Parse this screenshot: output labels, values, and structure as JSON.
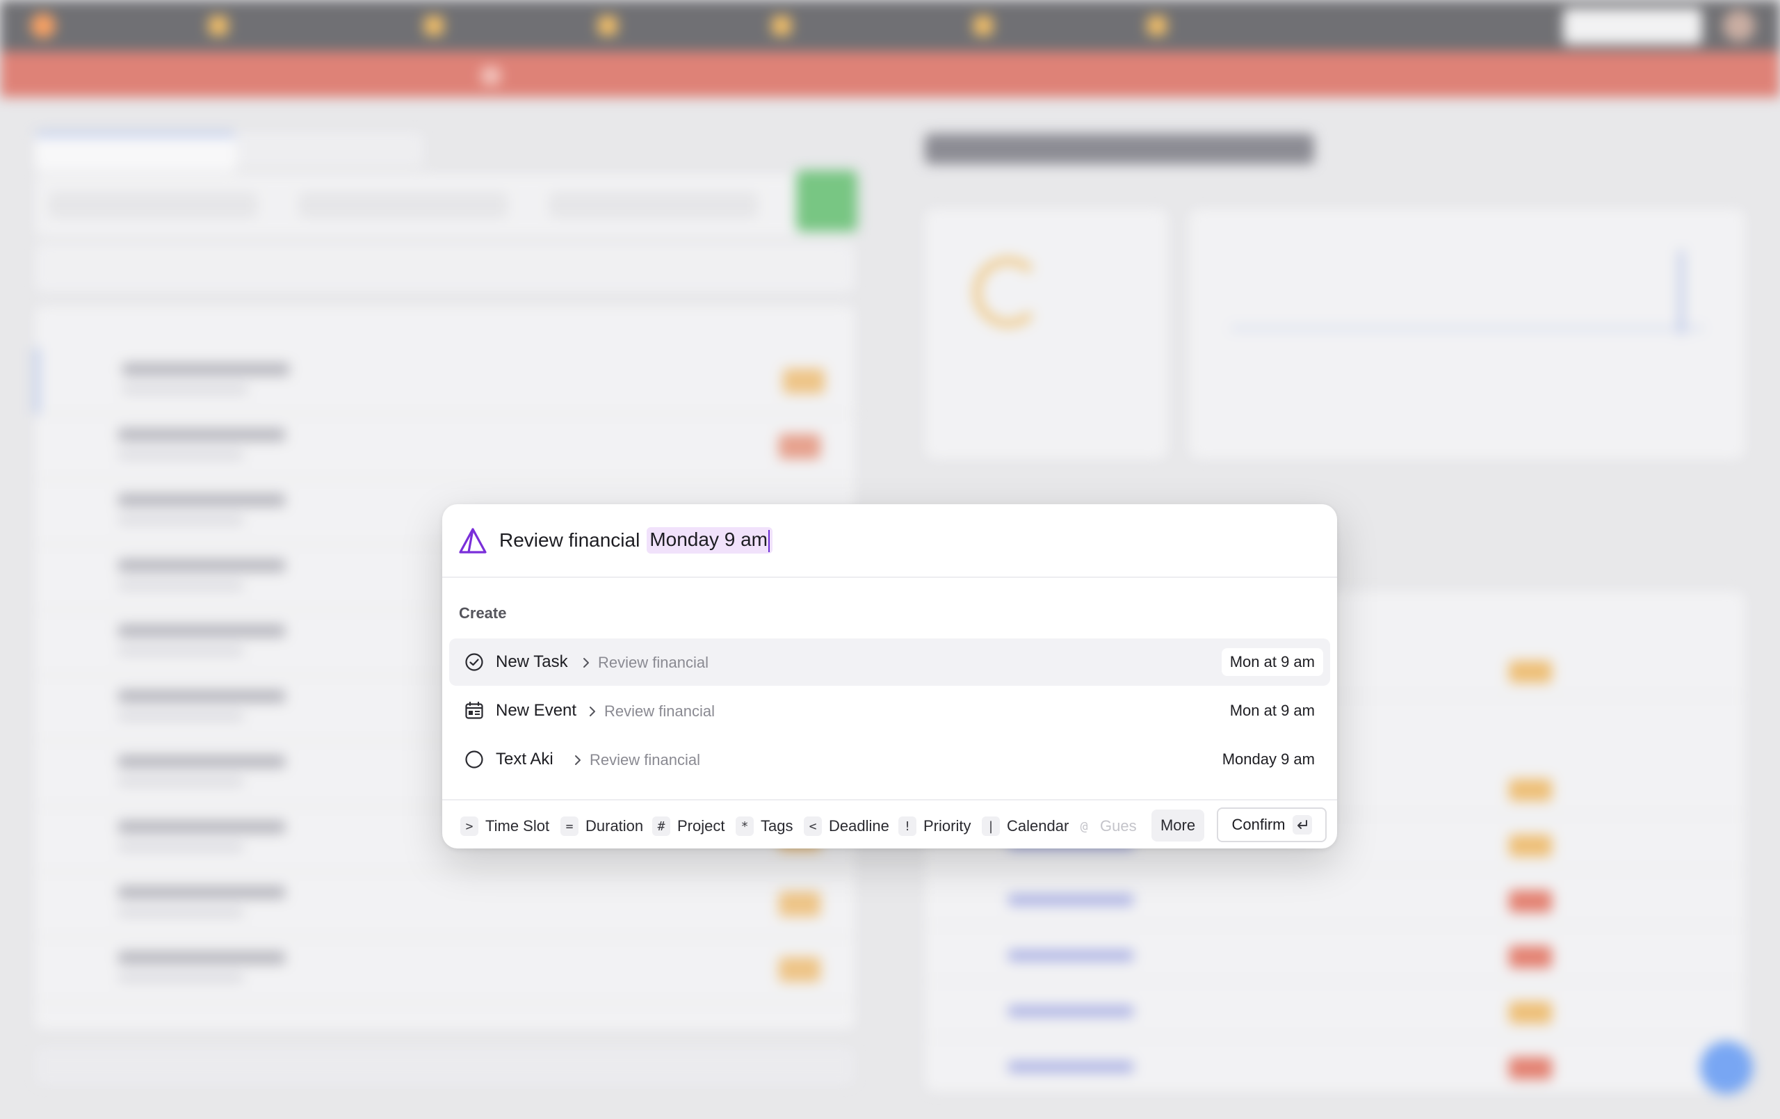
{
  "palette": {
    "query_text": "Review financial",
    "query_time": "Monday 9 am",
    "section_label": "Create",
    "options": [
      {
        "title": "New Task",
        "crumb": "Review financial",
        "when": "Mon at 9 am",
        "icon": "check-circle-icon",
        "active": true
      },
      {
        "title": "New Event",
        "crumb": "Review financial",
        "when": "Mon at 9 am",
        "icon": "calendar-event-icon",
        "active": false
      },
      {
        "title": "Text Aki",
        "crumb": "Review financial",
        "when": "Monday 9 am",
        "icon": "circle-icon",
        "active": false
      }
    ],
    "shortcuts": [
      {
        "key": ">",
        "label": "Time Slot"
      },
      {
        "key": "=",
        "label": "Duration"
      },
      {
        "key": "#",
        "label": "Project"
      },
      {
        "key": "*",
        "label": "Tags"
      },
      {
        "key": "<",
        "label": "Deadline"
      },
      {
        "key": "!",
        "label": "Priority"
      },
      {
        "key": "|",
        "label": "Calendar"
      },
      {
        "key": "@",
        "label": "Gues"
      }
    ],
    "more_label": "More",
    "confirm_label": "Confirm",
    "accent_color": "#6b2bd6",
    "highlight_color": "#f1e2fb"
  }
}
